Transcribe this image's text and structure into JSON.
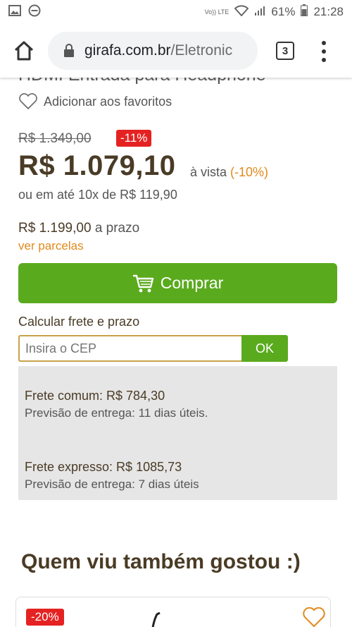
{
  "status_bar": {
    "battery": "61%",
    "time": "21:28",
    "net": "Vo)) LTE"
  },
  "browser": {
    "url_host": "girafa.com.br",
    "url_path": "/Eletronic",
    "tab_count": "3"
  },
  "product": {
    "title_partial": "HDMI Entrada para Headphone",
    "favorite_label": "Adicionar aos favoritos",
    "old_price": "R$ 1.349,00",
    "discount_badge": "-11%",
    "price": "R$ 1.079,10",
    "price_suffix": "à vista",
    "cash_discount": "(-10%)",
    "installments": "ou em até 10x de R$ 119,90",
    "term_price": "R$ 1.199,00",
    "term_label": "a prazo",
    "view_installments": "ver parcelas",
    "buy_label": "Comprar"
  },
  "shipping": {
    "label": "Calcular frete e prazo",
    "cep_placeholder": "Insira o CEP",
    "ok_label": "OK",
    "options": [
      {
        "title": "Frete comum: R$ 784,30",
        "eta": "Previsão de entrega: 11 dias úteis."
      },
      {
        "title": "Frete expresso: R$ 1085,73",
        "eta": "Previsão de entrega: 7 dias úteis"
      }
    ]
  },
  "related": {
    "title": "Quem viu também gostou :)",
    "first_discount": "-20%"
  },
  "colors": {
    "brand_green": "#5aaa1e",
    "brand_brown": "#4a3b26",
    "accent_orange": "#e08a1c",
    "discount_red": "#e52222"
  }
}
